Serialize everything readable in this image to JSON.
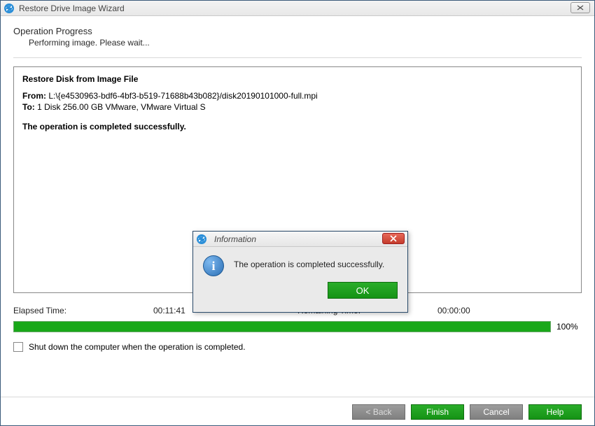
{
  "window": {
    "title": "Restore Drive Image Wizard"
  },
  "header": {
    "heading": "Operation Progress",
    "subheading": "Performing image. Please wait..."
  },
  "log": {
    "title": "Restore Disk from Image File",
    "from_label": "From:",
    "from_value": "L:\\{e4530963-bdf6-4bf3-b519-71688b43b082}/disk20190101000-full.mpi",
    "to_label": "To:",
    "to_value": "1 Disk 256.00 GB VMware, VMware Virtual S",
    "success": "The operation is completed successfully."
  },
  "times": {
    "elapsed_label": "Elapsed Time:",
    "elapsed_value": "00:11:41",
    "remaining_label": "Remaining Time:",
    "remaining_value": "00:00:00"
  },
  "progress": {
    "percent_text": "100%",
    "percent_value": 100
  },
  "shutdown": {
    "label": "Shut down the computer when the operation is completed.",
    "checked": false
  },
  "buttons": {
    "back": "< Back",
    "finish": "Finish",
    "cancel": "Cancel",
    "help": "Help"
  },
  "dialog": {
    "title": "Information",
    "message": "The operation is completed successfully.",
    "ok": "OK"
  }
}
